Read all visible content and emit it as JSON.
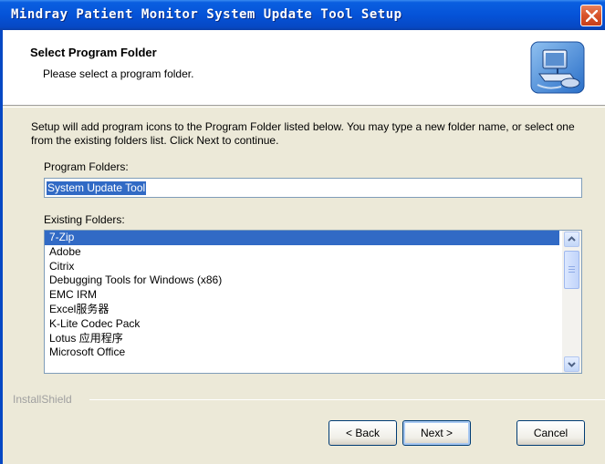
{
  "window": {
    "title": "Mindray Patient Monitor System Update Tool Setup"
  },
  "header": {
    "title": "Select Program Folder",
    "subtitle": "Please select a program folder.",
    "icon": "setup-computer-icon"
  },
  "body": {
    "description": "Setup will add program icons to the Program Folder listed below.  You may type a new folder name, or select one from the existing folders list.  Click Next to continue.",
    "program_folders_label": "Program Folders:",
    "program_folder_value": "System Update Tool",
    "existing_folders_label": "Existing Folders:",
    "existing_folders": [
      "7-Zip",
      "Adobe",
      "Citrix",
      "Debugging Tools for Windows (x86)",
      "EMC IRM",
      "Excel服务器",
      "K-Lite Codec Pack",
      "Lotus 应用程序",
      "Microsoft Office"
    ],
    "selected_folder": "7-Zip"
  },
  "footer": {
    "brand": "InstallShield",
    "back_label": "< Back",
    "next_label": "Next >",
    "cancel_label": "Cancel"
  },
  "colors": {
    "titlebar": "#0553d8",
    "selection": "#316ac5",
    "close": "#d8532a"
  }
}
